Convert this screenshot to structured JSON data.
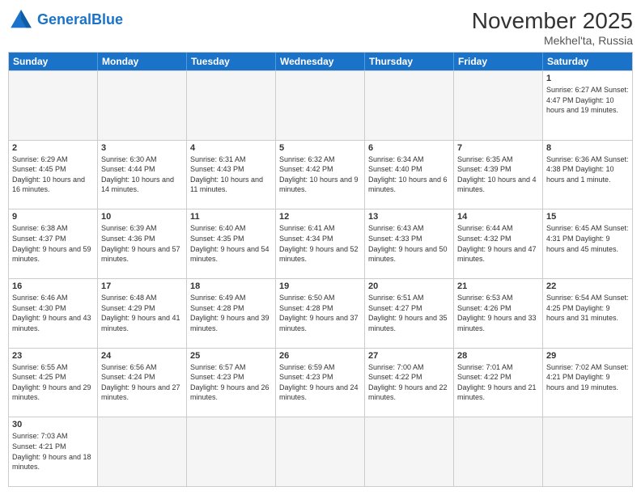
{
  "header": {
    "logo_general": "General",
    "logo_blue": "Blue",
    "month_title": "November 2025",
    "location": "Mekhel'ta, Russia"
  },
  "weekdays": [
    "Sunday",
    "Monday",
    "Tuesday",
    "Wednesday",
    "Thursday",
    "Friday",
    "Saturday"
  ],
  "rows": [
    [
      {
        "day": "",
        "info": "",
        "empty": true
      },
      {
        "day": "",
        "info": "",
        "empty": true
      },
      {
        "day": "",
        "info": "",
        "empty": true
      },
      {
        "day": "",
        "info": "",
        "empty": true
      },
      {
        "day": "",
        "info": "",
        "empty": true
      },
      {
        "day": "",
        "info": "",
        "empty": true
      },
      {
        "day": "1",
        "info": "Sunrise: 6:27 AM\nSunset: 4:47 PM\nDaylight: 10 hours\nand 19 minutes.",
        "empty": false
      }
    ],
    [
      {
        "day": "2",
        "info": "Sunrise: 6:29 AM\nSunset: 4:45 PM\nDaylight: 10 hours\nand 16 minutes.",
        "empty": false
      },
      {
        "day": "3",
        "info": "Sunrise: 6:30 AM\nSunset: 4:44 PM\nDaylight: 10 hours\nand 14 minutes.",
        "empty": false
      },
      {
        "day": "4",
        "info": "Sunrise: 6:31 AM\nSunset: 4:43 PM\nDaylight: 10 hours\nand 11 minutes.",
        "empty": false
      },
      {
        "day": "5",
        "info": "Sunrise: 6:32 AM\nSunset: 4:42 PM\nDaylight: 10 hours\nand 9 minutes.",
        "empty": false
      },
      {
        "day": "6",
        "info": "Sunrise: 6:34 AM\nSunset: 4:40 PM\nDaylight: 10 hours\nand 6 minutes.",
        "empty": false
      },
      {
        "day": "7",
        "info": "Sunrise: 6:35 AM\nSunset: 4:39 PM\nDaylight: 10 hours\nand 4 minutes.",
        "empty": false
      },
      {
        "day": "8",
        "info": "Sunrise: 6:36 AM\nSunset: 4:38 PM\nDaylight: 10 hours\nand 1 minute.",
        "empty": false
      }
    ],
    [
      {
        "day": "9",
        "info": "Sunrise: 6:38 AM\nSunset: 4:37 PM\nDaylight: 9 hours\nand 59 minutes.",
        "empty": false
      },
      {
        "day": "10",
        "info": "Sunrise: 6:39 AM\nSunset: 4:36 PM\nDaylight: 9 hours\nand 57 minutes.",
        "empty": false
      },
      {
        "day": "11",
        "info": "Sunrise: 6:40 AM\nSunset: 4:35 PM\nDaylight: 9 hours\nand 54 minutes.",
        "empty": false
      },
      {
        "day": "12",
        "info": "Sunrise: 6:41 AM\nSunset: 4:34 PM\nDaylight: 9 hours\nand 52 minutes.",
        "empty": false
      },
      {
        "day": "13",
        "info": "Sunrise: 6:43 AM\nSunset: 4:33 PM\nDaylight: 9 hours\nand 50 minutes.",
        "empty": false
      },
      {
        "day": "14",
        "info": "Sunrise: 6:44 AM\nSunset: 4:32 PM\nDaylight: 9 hours\nand 47 minutes.",
        "empty": false
      },
      {
        "day": "15",
        "info": "Sunrise: 6:45 AM\nSunset: 4:31 PM\nDaylight: 9 hours\nand 45 minutes.",
        "empty": false
      }
    ],
    [
      {
        "day": "16",
        "info": "Sunrise: 6:46 AM\nSunset: 4:30 PM\nDaylight: 9 hours\nand 43 minutes.",
        "empty": false
      },
      {
        "day": "17",
        "info": "Sunrise: 6:48 AM\nSunset: 4:29 PM\nDaylight: 9 hours\nand 41 minutes.",
        "empty": false
      },
      {
        "day": "18",
        "info": "Sunrise: 6:49 AM\nSunset: 4:28 PM\nDaylight: 9 hours\nand 39 minutes.",
        "empty": false
      },
      {
        "day": "19",
        "info": "Sunrise: 6:50 AM\nSunset: 4:28 PM\nDaylight: 9 hours\nand 37 minutes.",
        "empty": false
      },
      {
        "day": "20",
        "info": "Sunrise: 6:51 AM\nSunset: 4:27 PM\nDaylight: 9 hours\nand 35 minutes.",
        "empty": false
      },
      {
        "day": "21",
        "info": "Sunrise: 6:53 AM\nSunset: 4:26 PM\nDaylight: 9 hours\nand 33 minutes.",
        "empty": false
      },
      {
        "day": "22",
        "info": "Sunrise: 6:54 AM\nSunset: 4:25 PM\nDaylight: 9 hours\nand 31 minutes.",
        "empty": false
      }
    ],
    [
      {
        "day": "23",
        "info": "Sunrise: 6:55 AM\nSunset: 4:25 PM\nDaylight: 9 hours\nand 29 minutes.",
        "empty": false
      },
      {
        "day": "24",
        "info": "Sunrise: 6:56 AM\nSunset: 4:24 PM\nDaylight: 9 hours\nand 27 minutes.",
        "empty": false
      },
      {
        "day": "25",
        "info": "Sunrise: 6:57 AM\nSunset: 4:23 PM\nDaylight: 9 hours\nand 26 minutes.",
        "empty": false
      },
      {
        "day": "26",
        "info": "Sunrise: 6:59 AM\nSunset: 4:23 PM\nDaylight: 9 hours\nand 24 minutes.",
        "empty": false
      },
      {
        "day": "27",
        "info": "Sunrise: 7:00 AM\nSunset: 4:22 PM\nDaylight: 9 hours\nand 22 minutes.",
        "empty": false
      },
      {
        "day": "28",
        "info": "Sunrise: 7:01 AM\nSunset: 4:22 PM\nDaylight: 9 hours\nand 21 minutes.",
        "empty": false
      },
      {
        "day": "29",
        "info": "Sunrise: 7:02 AM\nSunset: 4:21 PM\nDaylight: 9 hours\nand 19 minutes.",
        "empty": false
      }
    ],
    [
      {
        "day": "30",
        "info": "Sunrise: 7:03 AM\nSunset: 4:21 PM\nDaylight: 9 hours\nand 18 minutes.",
        "empty": false
      },
      {
        "day": "",
        "info": "",
        "empty": true
      },
      {
        "day": "",
        "info": "",
        "empty": true
      },
      {
        "day": "",
        "info": "",
        "empty": true
      },
      {
        "day": "",
        "info": "",
        "empty": true
      },
      {
        "day": "",
        "info": "",
        "empty": true
      },
      {
        "day": "",
        "info": "",
        "empty": true
      }
    ]
  ]
}
